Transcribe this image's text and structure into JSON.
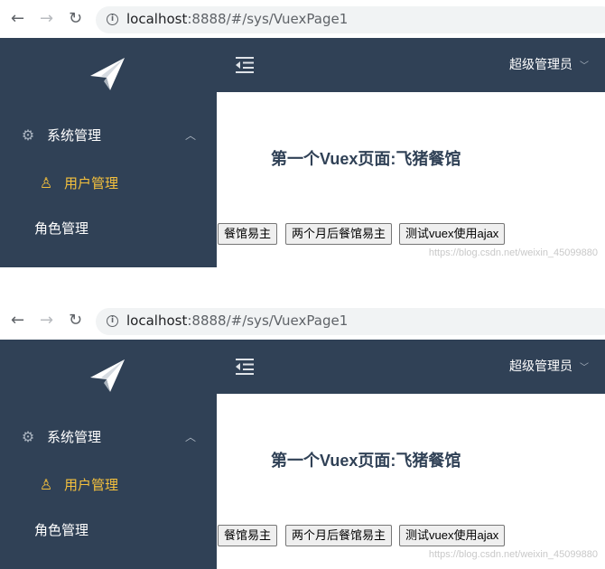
{
  "browser": {
    "url_host": "localhost",
    "url_path": ":8888/#/sys/VuexPage1",
    "back_icon": "←",
    "forward_icon": "→",
    "reload_icon": "↻",
    "info_icon": "i"
  },
  "sidebar": {
    "logo": "paper-plane-icon",
    "items": [
      {
        "label": "系统管理",
        "icon": "⚙",
        "caret": "︿"
      },
      {
        "label": "用户管理",
        "icon": "♙"
      },
      {
        "label": "角色管理"
      }
    ]
  },
  "header": {
    "user_name": "超级管理员",
    "user_dropdown_icon": "﹀"
  },
  "main": {
    "title": "第一个Vuex页面:飞猪餐馆",
    "buttons": [
      "餐馆易主",
      "两个月后餐馆易主",
      "测试vuex使用ajax"
    ],
    "watermark": "https://blog.csdn.net/weixin_45099880"
  },
  "colors": {
    "sidebar_bg": "#304156",
    "active": "#f5c13d",
    "title": "#304156"
  }
}
